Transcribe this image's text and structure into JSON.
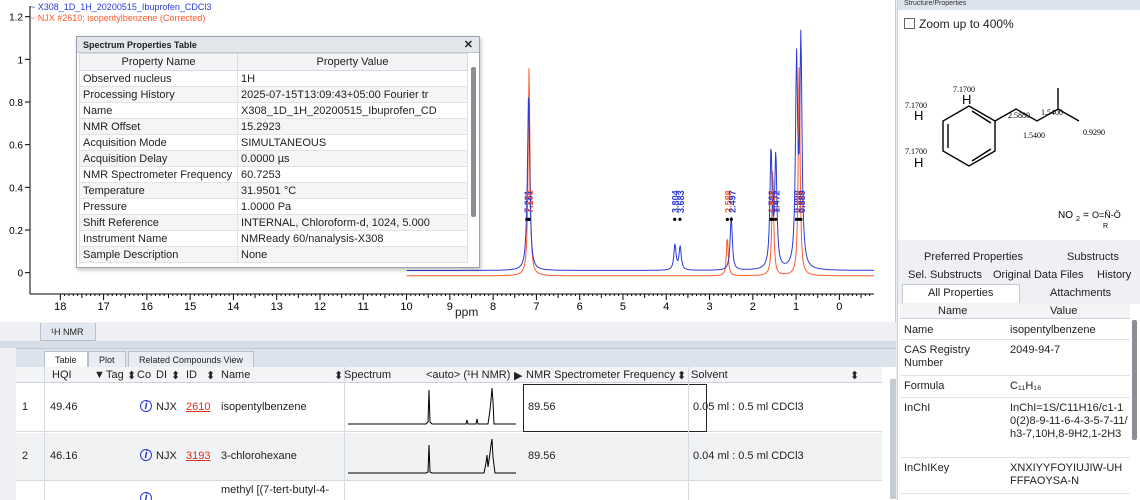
{
  "legend": {
    "line1": "~ X308_1D_1H_20200515_Ibuprofen_CDCl3",
    "line2": "~ NJX #2610; isopentylbenzene (Corrected)"
  },
  "colors": {
    "blue_trace": "#2a3bd6",
    "red_trace": "#ff5a2a"
  },
  "chart_data": {
    "type": "line",
    "xlabel": "ppm",
    "xlim": [
      18.7,
      -0.8
    ],
    "ylim": [
      -0.1,
      1.25
    ],
    "x_ticks": [
      "18",
      "17",
      "16",
      "15",
      "14",
      "13",
      "12",
      "11",
      "10",
      "9",
      "8",
      "7",
      "6",
      "5",
      "4",
      "3",
      "2",
      "1",
      "0"
    ],
    "y_ticks": [
      "0",
      "0.2",
      "0.4",
      "0.6",
      "0.8",
      "1",
      "1.2"
    ],
    "peak_labels": [
      {
        "ppm": 7.221,
        "label": "7.221",
        "color": "blue"
      },
      {
        "ppm": 7.181,
        "label": "7.181",
        "color": "blue"
      },
      {
        "ppm": 7.17,
        "label": "7.170",
        "color": "red"
      },
      {
        "ppm": 3.804,
        "label": "3.804",
        "color": "blue"
      },
      {
        "ppm": 3.683,
        "label": "3.683",
        "color": "blue"
      },
      {
        "ppm": 2.588,
        "label": "2.588",
        "color": "red"
      },
      {
        "ppm": 2.497,
        "label": "2.497",
        "color": "blue"
      },
      {
        "ppm": 1.583,
        "label": "1.583",
        "color": "blue"
      },
      {
        "ppm": 1.54,
        "label": "1.540",
        "color": "red"
      },
      {
        "ppm": 1.472,
        "label": "1.472",
        "color": "blue"
      },
      {
        "ppm": 0.99,
        "label": "0.990",
        "color": "blue"
      },
      {
        "ppm": 0.929,
        "label": "0.929",
        "color": "red"
      },
      {
        "ppm": 0.889,
        "label": "0.889",
        "color": "blue"
      }
    ],
    "series": [
      {
        "name": "X308_1D_1H_20200515_Ibuprofen_CDCl3",
        "peaks": [
          [
            7.22,
            0.05
          ],
          [
            7.18,
            0.82
          ],
          [
            3.8,
            0.12
          ],
          [
            3.68,
            0.11
          ],
          [
            2.5,
            0.25
          ],
          [
            1.58,
            0.55
          ],
          [
            1.47,
            0.52
          ],
          [
            0.99,
            0.95
          ],
          [
            0.89,
            1.05
          ]
        ]
      },
      {
        "name": "NJX #2610; isopentylbenzene (Corrected)",
        "peaks": [
          [
            7.17,
            0.98
          ],
          [
            2.59,
            0.18
          ],
          [
            1.54,
            0.5
          ],
          [
            0.93,
            1.0
          ]
        ]
      }
    ]
  },
  "prop_table": {
    "title": "Spectrum Properties Table",
    "col_name": "Property Name",
    "col_value": "Property Value",
    "rows": [
      {
        "name": "Observed nucleus",
        "value": "1H"
      },
      {
        "name": "Processing History",
        "value": "2025-07-15T13:09:43+05:00 Fourier tr"
      },
      {
        "name": "Name",
        "value": "X308_1D_1H_20200515_Ibuprofen_CD"
      },
      {
        "name": "NMR Offset",
        "value": "15.2923"
      },
      {
        "name": "Acquisition Mode",
        "value": "SIMULTANEOUS"
      },
      {
        "name": "Acquisition Delay",
        "value": "0.0000 µs"
      },
      {
        "name": "NMR Spectrometer Frequency",
        "value": "60.7253"
      },
      {
        "name": "Temperature",
        "value": "31.9501 °C"
      },
      {
        "name": "Pressure",
        "value": "1.0000 Pa"
      },
      {
        "name": "Shift Reference",
        "value": "INTERNAL, Chloroform-d, 1024, 5.000"
      },
      {
        "name": "Instrument Name",
        "value": "NMReady 60/nanalysis-X308"
      },
      {
        "name": "Sample Description",
        "value": "None"
      }
    ]
  },
  "spectrum_tab": "¹H NMR",
  "result_tabs": [
    "Table",
    "Plot",
    "Related Compounds View"
  ],
  "grid": {
    "headers": {
      "hqi": "HQI",
      "tag": "Tag",
      "co": "Co",
      "di": "DI",
      "id": "ID",
      "name": "Name",
      "spectrum": "Spectrum",
      "auto": "<auto> (¹H NMR)",
      "freq": "NMR Spectrometer Frequency",
      "solvent": "Solvent"
    },
    "rows": [
      {
        "index": "1",
        "hqi": "49.46",
        "db": "NJX",
        "id": "2610",
        "name": "isopentylbenzene",
        "freq": "89.56",
        "solvent": "0.05 ml : 0.5 ml CDCl3"
      },
      {
        "index": "2",
        "hqi": "46.16",
        "db": "NJX",
        "id": "3193",
        "name": "3-chlorohexane",
        "freq": "89.56",
        "solvent": "0.04 ml : 0.5 ml CDCl3"
      },
      {
        "index": "",
        "hqi": "",
        "db": "",
        "id": "",
        "name": "methyl [(7-tert-butyl-4-",
        "freq": "",
        "solvent": ""
      }
    ]
  },
  "structure": {
    "title": "Structure/Properties",
    "zoom_label": "Zoom up to 400%",
    "shift_labels": [
      "7.1700",
      "7.1700",
      "7.1700",
      "2.5880",
      "1.5400",
      "1.5400",
      "0.9290"
    ],
    "atom_h": "H",
    "nitro_label": "NO"
  },
  "props_panel": {
    "tabs_row1": [
      "Preferred Properties",
      "Substructs"
    ],
    "tabs_row2": [
      "Sel. Substructs",
      "Original Data Files",
      "History"
    ],
    "tabs_row3": [
      "All Properties",
      "Attachments"
    ],
    "col_name": "Name",
    "col_value": "Value",
    "rows": [
      {
        "name": "Name",
        "value": "isopentylbenzene"
      },
      {
        "name": "CAS Registry Number",
        "value": "2049-94-7"
      },
      {
        "name": "Formula",
        "value": "C₁₁H₁₆"
      },
      {
        "name": "InChI",
        "value": "InChI=1S/C11H16/c1-10(2)8-9-11-6-4-3-5-7-11/h3-7,10H,8-9H2,1-2H3"
      },
      {
        "name": "InChIKey",
        "value": "XNXIYYFOYIUJIW-UHFFFAOYSA-N"
      }
    ]
  }
}
